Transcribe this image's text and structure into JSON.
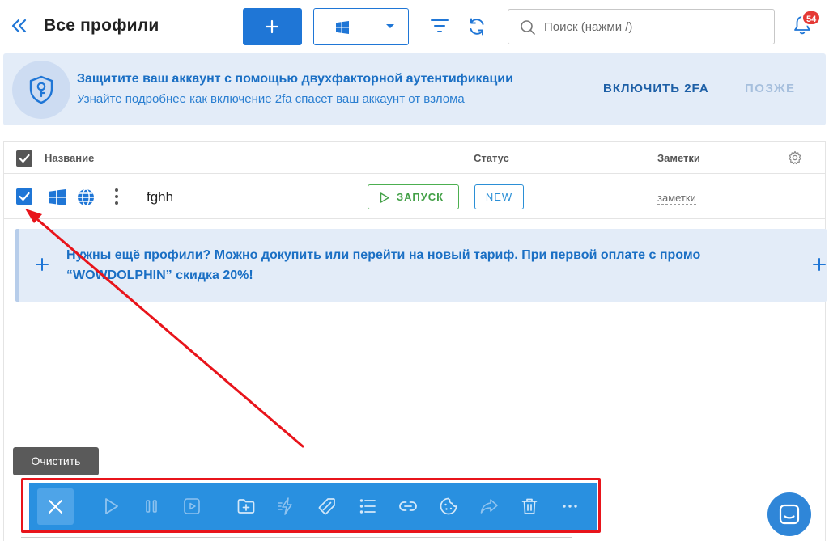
{
  "header": {
    "title": "Все профили",
    "search_placeholder": "Поиск (нажми /)",
    "notification_count": "54"
  },
  "twofa": {
    "title": "Защитите ваш аккаунт с помощью двухфакторной аутентификации",
    "link": "Узнайте подробнее",
    "description_rest": " как включение 2fa спасет ваш аккаунт от взлома",
    "enable_label": "ВКЛЮЧИТЬ 2FA",
    "later_label": "ПОЗЖЕ"
  },
  "table": {
    "columns": {
      "name": "Название",
      "status": "Статус",
      "notes": "Заметки"
    },
    "rows": [
      {
        "name": "fghh",
        "launch_label": "ЗАПУСК",
        "status": "NEW",
        "notes": "заметки",
        "checked": true
      }
    ]
  },
  "promo": {
    "text": "Нужны ещё профили? Можно докупить или перейти на новый тариф. При первой оплате с промо “WOWDOLPHIN” скидка 20%!"
  },
  "tooltip": {
    "label": "Очистить"
  },
  "toolbar": {
    "icons": [
      "close-icon",
      "play-icon",
      "pause-icon",
      "play-frame-icon",
      "add-folder-icon",
      "proxy-icon",
      "tag-icon",
      "list-icon",
      "link-icon",
      "cookie-icon",
      "share-icon",
      "trash-icon",
      "more-icon"
    ]
  },
  "colors": {
    "primary": "#1f76d6",
    "toolbar": "#2990e0",
    "banner_bg": "#e3ecf8",
    "highlight_red": "#e8141b",
    "launch_green": "#43a047"
  }
}
